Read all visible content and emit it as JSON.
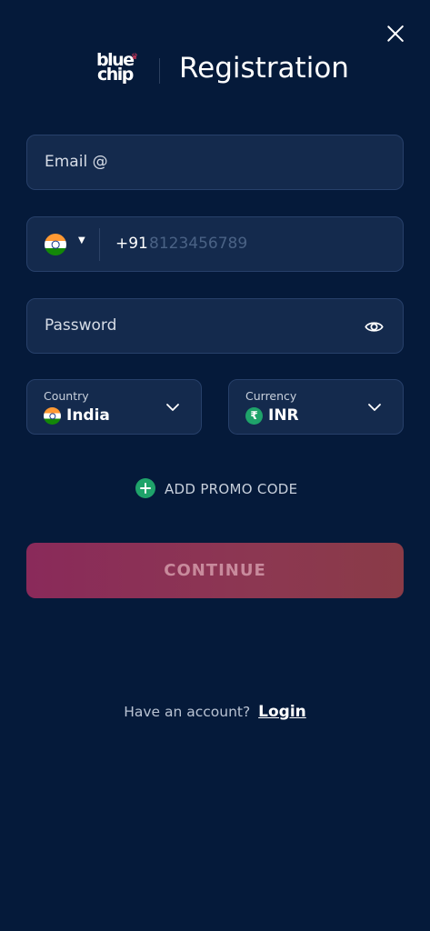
{
  "header": {
    "logo_line1": "blue",
    "logo_line2": "chip",
    "title": "Registration"
  },
  "form": {
    "email": {
      "placeholder": "Email @"
    },
    "phone": {
      "country_code": "+91",
      "placeholder": "8123456789",
      "flag": "india-flag"
    },
    "password": {
      "placeholder": "Password",
      "toggle_icon": "eye-icon"
    },
    "country": {
      "label": "Country",
      "value": "India",
      "flag": "india-flag"
    },
    "currency": {
      "label": "Currency",
      "value": "INR",
      "icon_symbol": "₹"
    },
    "promo_label": "ADD PROMO CODE",
    "continue_label": "CONTINUE"
  },
  "footer": {
    "prompt": "Have an account?",
    "login_label": "Login"
  },
  "colors": {
    "background": "#051a3a",
    "field_bg": "#142a4d",
    "accent_green": "#1fa36a",
    "button_gradient_start": "#8a2a5a",
    "button_gradient_end": "#8a3b47"
  }
}
